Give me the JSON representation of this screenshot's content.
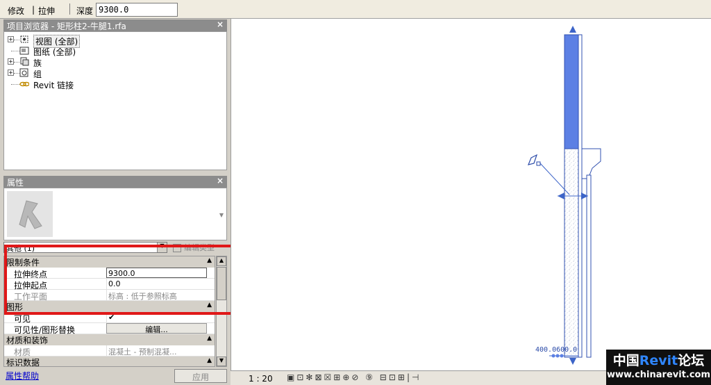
{
  "context_bar": {
    "modify_label": "修改",
    "divider": "|",
    "mode_label": "拉伸",
    "depth_label": "深度",
    "depth_value": "9300.0"
  },
  "project_browser": {
    "title": "项目浏览器 - 矩形柱2-牛腿1.rfa",
    "close_glyph": "×",
    "items": [
      {
        "label": "视图 (全部)",
        "expander": "+",
        "icon": "views-icon"
      },
      {
        "label": "图纸 (全部)",
        "expander": "",
        "icon": "sheets-icon"
      },
      {
        "label": "族",
        "expander": "+",
        "icon": "families-icon"
      },
      {
        "label": "组",
        "expander": "+",
        "icon": "groups-icon"
      },
      {
        "label": "Revit 链接",
        "expander": "",
        "icon": "revit-link-icon"
      }
    ]
  },
  "properties": {
    "title": "属性",
    "close_glyph": "×",
    "type_selector": "其他 (1)",
    "edit_type_label": "编辑类型",
    "sections": {
      "constraints": {
        "label": "限制条件",
        "arrow": "▲"
      },
      "graphics": {
        "label": "图形",
        "arrow": "▲"
      },
      "materials": {
        "label": "材质和装饰",
        "arrow": "▲"
      },
      "identity": {
        "label": "标识数据",
        "arrow": "▲"
      }
    },
    "rows": {
      "extrusion_end": {
        "label": "拉伸终点",
        "value": "9300.0"
      },
      "extrusion_start": {
        "label": "拉伸起点",
        "value": "0.0"
      },
      "work_plane": {
        "label": "工作平面",
        "value": "标高 : 低于参照标高"
      },
      "visible": {
        "label": "可见",
        "value": "✔"
      },
      "visibility_override": {
        "label": "可见性/图形替换",
        "button": "编辑..."
      },
      "material": {
        "label": "材质",
        "value": "混凝土 - 预制混凝..."
      }
    },
    "help_link": "属性帮助",
    "apply_button": "应用"
  },
  "view": {
    "dimension_text": "400.0600.0"
  },
  "status_bar": {
    "scale": "1 : 20",
    "icons_text": "▣⊡✻⊠☒⊞⊕⊘ ⑨ ⊟⊡⊞|⊣"
  },
  "watermark": {
    "prefix": "中国",
    "revit": "Revit",
    "suffix": "论坛",
    "url": "www.chinarevit.com"
  },
  "colors": {
    "accent_blue": "#5c80e4",
    "highlight_red": "#e01818"
  }
}
